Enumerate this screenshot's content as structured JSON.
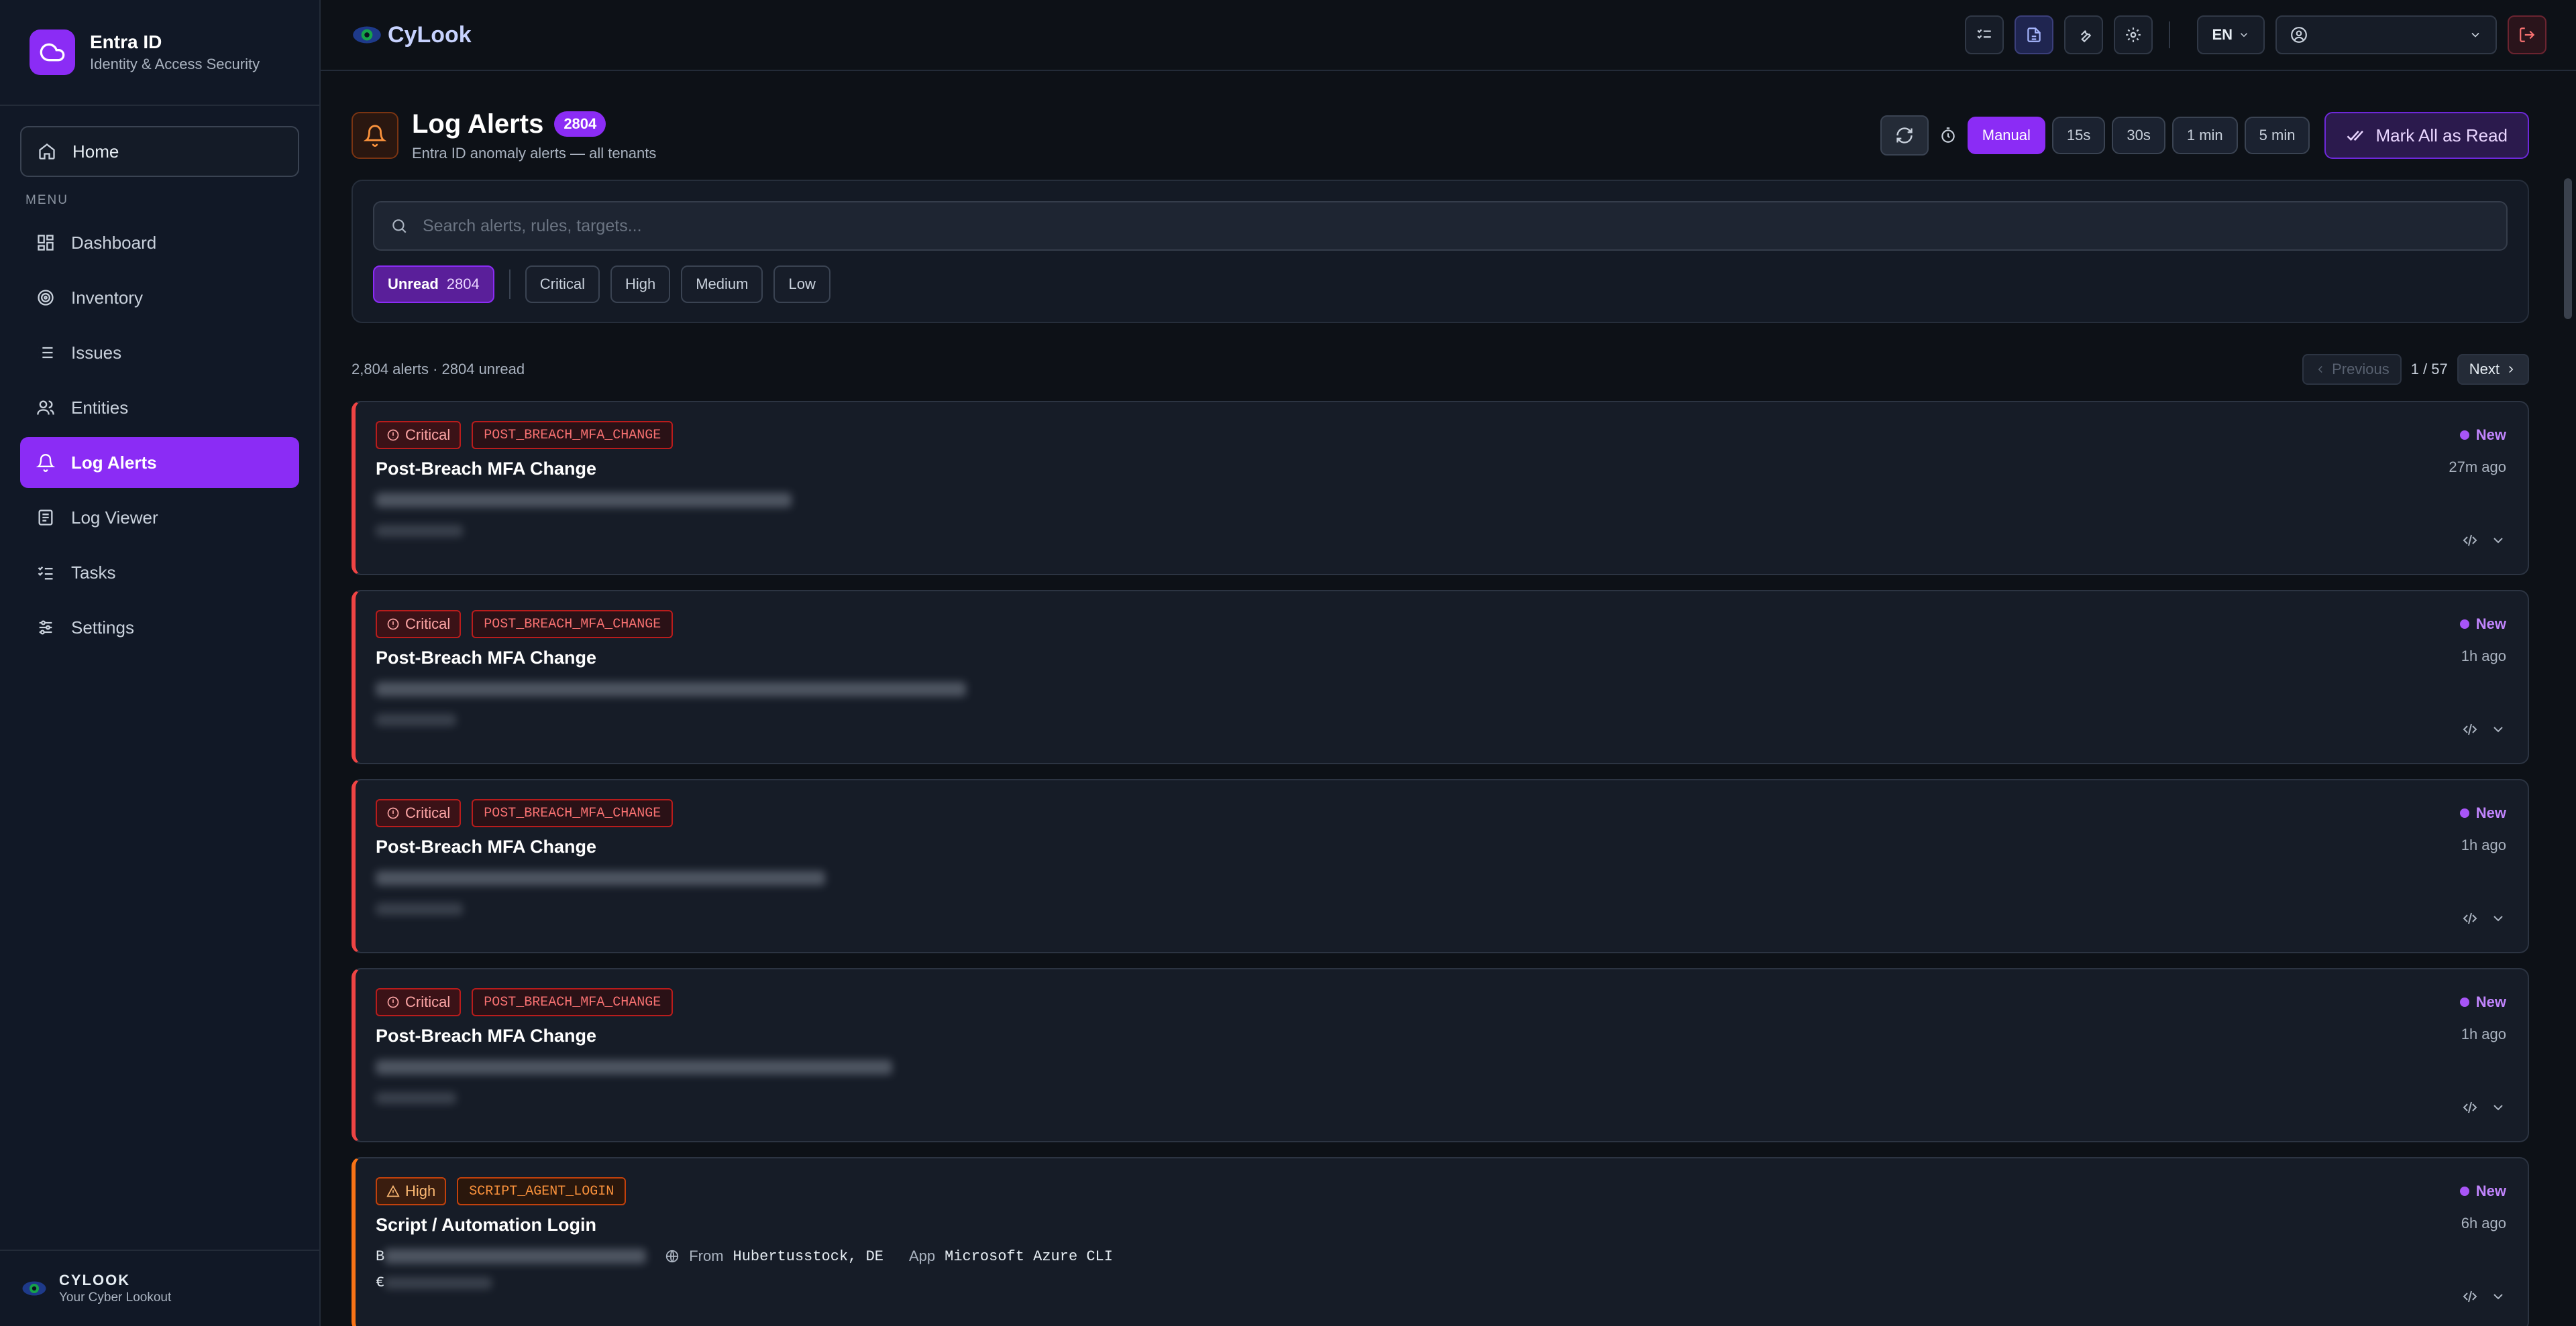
{
  "sidebar": {
    "brand_title": "Entra ID",
    "brand_subtitle": "Identity & Access Security",
    "home_label": "Home",
    "menu_label": "MENU",
    "items": [
      {
        "label": "Dashboard",
        "icon": "grid-icon"
      },
      {
        "label": "Inventory",
        "icon": "target-icon"
      },
      {
        "label": "Issues",
        "icon": "list-icon"
      },
      {
        "label": "Entities",
        "icon": "users-icon"
      },
      {
        "label": "Log Alerts",
        "icon": "bell-icon",
        "active": true
      },
      {
        "label": "Log Viewer",
        "icon": "log-icon"
      },
      {
        "label": "Tasks",
        "icon": "tasks-icon"
      },
      {
        "label": "Settings",
        "icon": "sliders-icon"
      }
    ],
    "footer_title": "CYLOOK",
    "footer_subtitle": "Your Cyber Lookout"
  },
  "topbar": {
    "logo_text": "CyLook",
    "language": "EN"
  },
  "page": {
    "title": "Log Alerts",
    "count_badge": "2804",
    "subtitle": "Entra ID anomaly alerts — all tenants",
    "refresh_options": [
      "Manual",
      "15s",
      "30s",
      "1 min",
      "5 min"
    ],
    "refresh_selected": "Manual",
    "mark_all_label": "Mark All as Read"
  },
  "filters": {
    "search_placeholder": "Search alerts, rules, targets...",
    "unread_label": "Unread",
    "unread_count": "2804",
    "severity_chips": [
      "Critical",
      "High",
      "Medium",
      "Low"
    ]
  },
  "list": {
    "summary": "2,804 alerts · 2804 unread",
    "prev_label": "Previous",
    "page_indicator": "1 / 57",
    "next_label": "Next"
  },
  "alerts": [
    {
      "severity": "Critical",
      "rule": "POST_BREACH_MFA_CHANGE",
      "title": "Post-Breach MFA Change",
      "status": "New",
      "time": "27m ago"
    },
    {
      "severity": "Critical",
      "rule": "POST_BREACH_MFA_CHANGE",
      "title": "Post-Breach MFA Change",
      "status": "New",
      "time": "1h ago"
    },
    {
      "severity": "Critical",
      "rule": "POST_BREACH_MFA_CHANGE",
      "title": "Post-Breach MFA Change",
      "status": "New",
      "time": "1h ago"
    },
    {
      "severity": "Critical",
      "rule": "POST_BREACH_MFA_CHANGE",
      "title": "Post-Breach MFA Change",
      "status": "New",
      "time": "1h ago"
    },
    {
      "severity": "High",
      "rule": "SCRIPT_AGENT_LOGIN",
      "title": "Script / Automation Login",
      "status": "New",
      "time": "6h ago",
      "user_prefix": "B",
      "from_label": "From",
      "from_value": "Hubertusstock, DE",
      "app_label": "App",
      "app_value": "Microsoft Azure CLI",
      "second_prefix": "€"
    }
  ],
  "colors": {
    "accent": "#8b2cf5",
    "critical": "#ef4444",
    "high": "#f97316"
  }
}
